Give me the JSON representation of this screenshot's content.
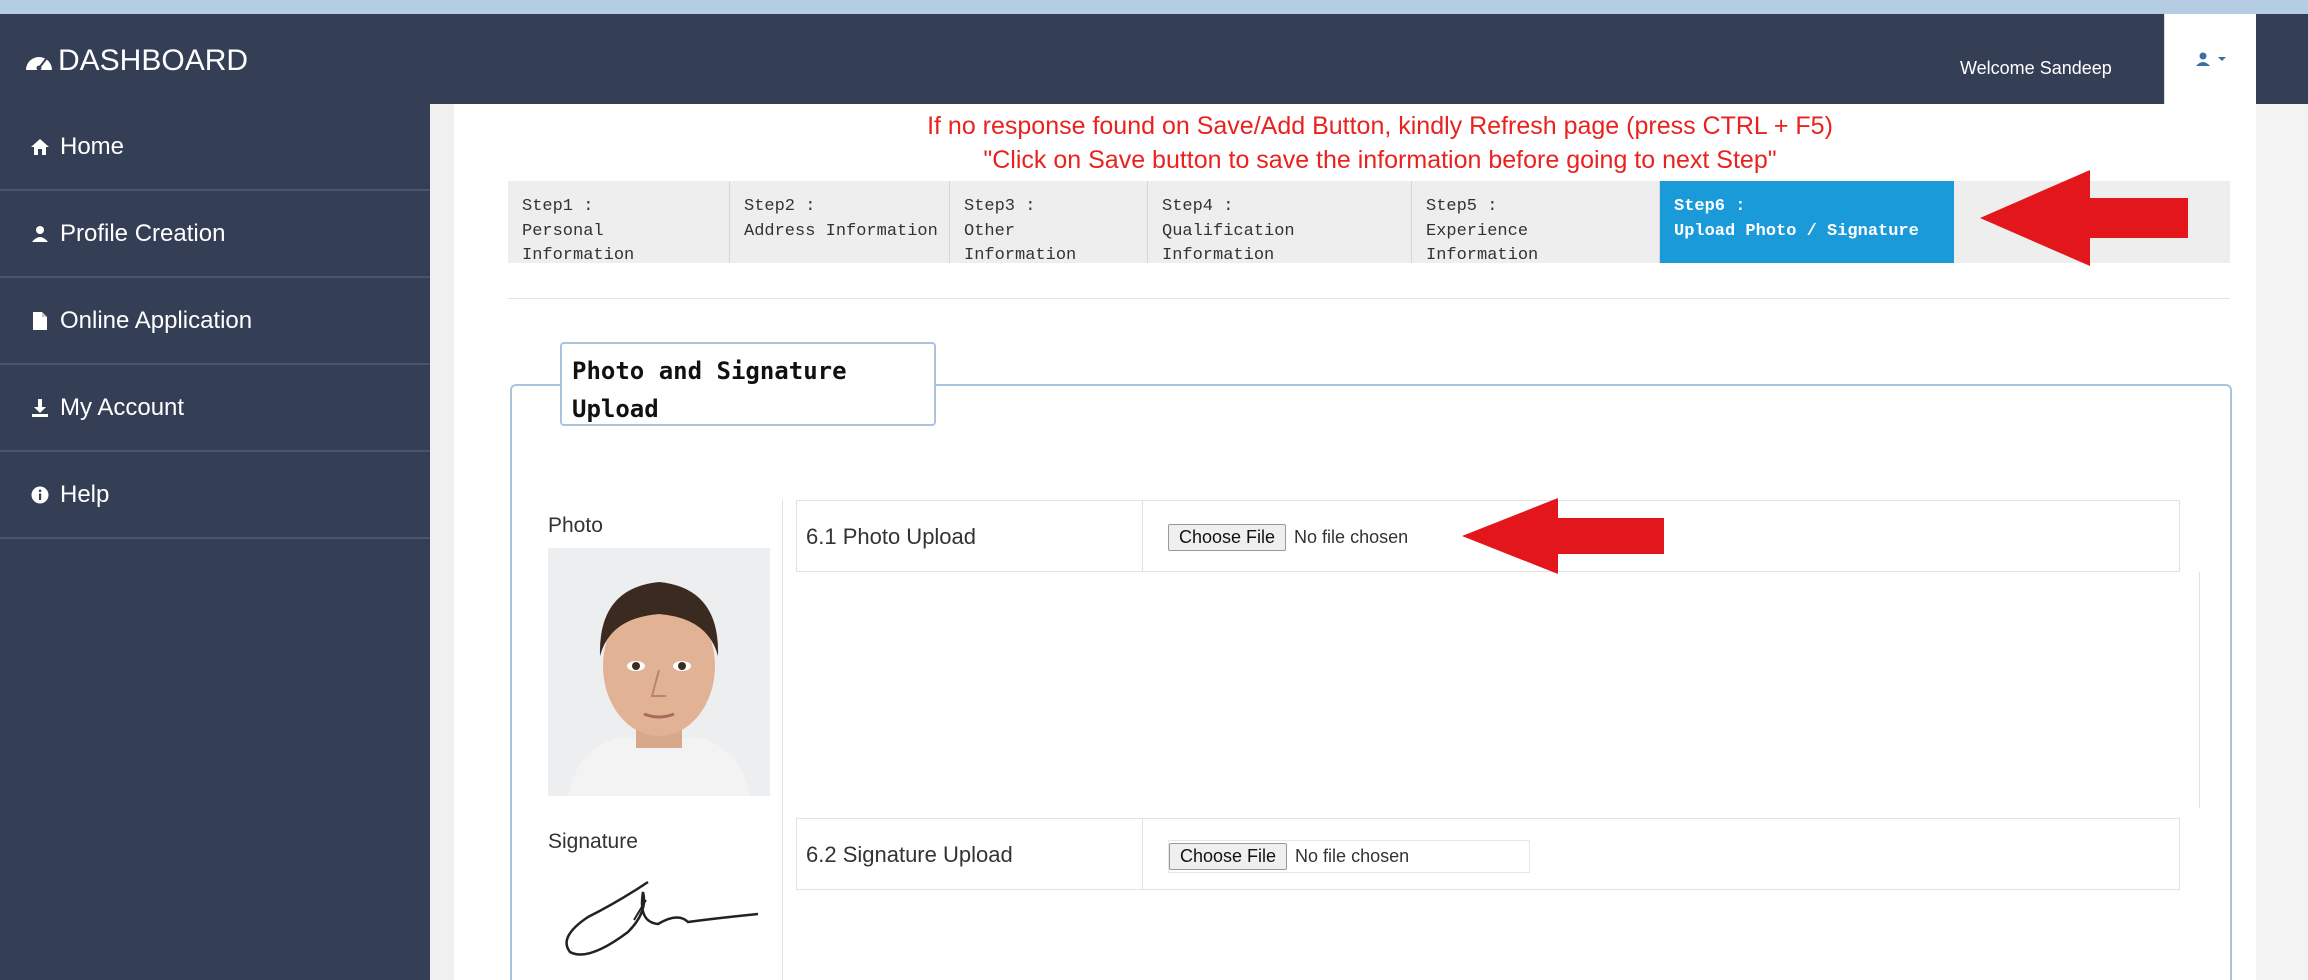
{
  "navbar": {
    "brand": "DASHBOARD",
    "welcome": "Welcome Sandeep"
  },
  "sidebar": {
    "items": [
      {
        "label": "Home",
        "icon": "home-icon"
      },
      {
        "label": "Profile Creation",
        "icon": "user-icon"
      },
      {
        "label": "Online Application",
        "icon": "file-icon"
      },
      {
        "label": "My Account",
        "icon": "download-icon"
      },
      {
        "label": "Help",
        "icon": "info-icon"
      }
    ]
  },
  "notice": {
    "line1": "If no response found on Save/Add Button, kindly Refresh page (press CTRL + F5)",
    "line2": "\"Click on Save button to save the information before going to next Step\""
  },
  "steps": [
    {
      "step": "Step1 :",
      "name": "Personal Information"
    },
    {
      "step": "Step2 :",
      "name": "Address Information"
    },
    {
      "step": "Step3 :",
      "name": "Other Information"
    },
    {
      "step": "Step4 :",
      "name": "Qualification Information"
    },
    {
      "step": "Step5 :",
      "name": "Experience Information"
    },
    {
      "step": "Step6 :",
      "name": "Upload Photo / Signature"
    }
  ],
  "section": {
    "legend_line1": "Photo and Signature",
    "legend_line2": "Upload",
    "photo_label": "Photo",
    "signature_label": "Signature",
    "photo_upload_label": "6.1 Photo Upload",
    "signature_upload_label": "6.2 Signature Upload",
    "choose_file": "Choose File",
    "no_file": "No file chosen"
  },
  "colors": {
    "navbar": "#343e55",
    "active_step": "#1a9ad9",
    "notice": "#e8231f",
    "arrow": "#e3161b"
  }
}
